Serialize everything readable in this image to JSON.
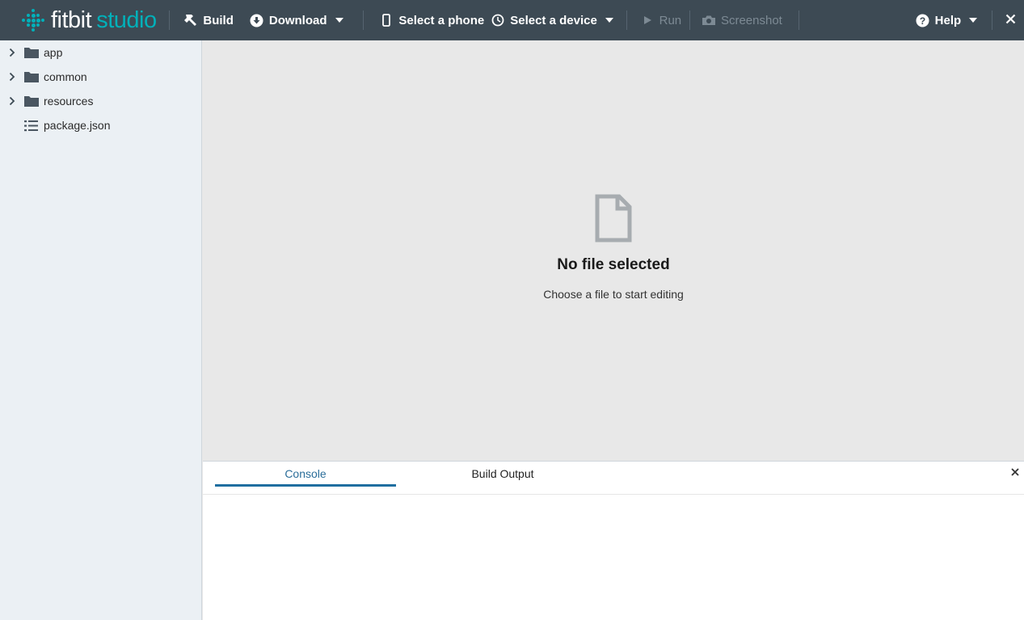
{
  "brand": {
    "part1": "fitbit",
    "part2": "studio",
    "accent": "#00b0b9"
  },
  "toolbar": {
    "build_label": "Build",
    "download_label": "Download",
    "phone_label": "Select a phone",
    "device_label": "Select a device",
    "run_label": "Run",
    "screenshot_label": "Screenshot",
    "help_label": "Help",
    "icons": [
      "hammer-icon",
      "download-icon",
      "phone-icon",
      "clock-icon",
      "play-icon",
      "camera-icon",
      "help-icon",
      "close-icon"
    ]
  },
  "sidebar": {
    "items": [
      {
        "label": "app",
        "type": "folder"
      },
      {
        "label": "common",
        "type": "folder"
      },
      {
        "label": "resources",
        "type": "folder"
      },
      {
        "label": "package.json",
        "type": "list-file"
      }
    ]
  },
  "editor": {
    "empty_title": "No file selected",
    "empty_subtitle": "Choose a file to start editing"
  },
  "panel": {
    "tabs": [
      {
        "label": "Console",
        "active": true
      },
      {
        "label": "Build Output",
        "active": false
      }
    ]
  },
  "colors": {
    "topbar": "#3d4a54",
    "sidebar": "#ebf0f4",
    "tab_active": "#1f6ea0"
  }
}
